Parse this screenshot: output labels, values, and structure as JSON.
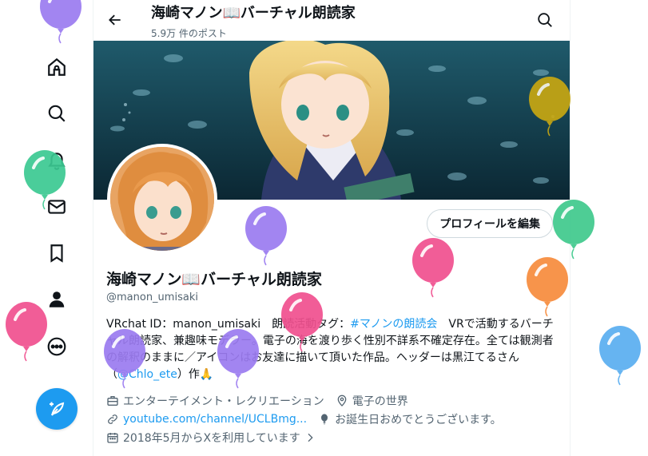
{
  "header": {
    "title": "海崎マノン📖バーチャル朗読家",
    "post_count": "5.9万 件のポスト"
  },
  "profile": {
    "edit_button": "プロフィールを編集",
    "name": "海崎マノン📖バーチャル朗読家",
    "handle": "@manon_umisaki",
    "bio": {
      "part1": "VRchat ID：manon_umisaki　朗読活動タグ：",
      "hashtag": "#マノンの朗読会",
      "part2": "　VRで活動するバーチャル朗読家、兼趣味モデラー。電子の海を渡り歩く性別不詳系不確定存在。全ては観測者の解釈のままに／アイコンはお友達に描いて頂いた作品。ヘッダーは黒江てるさん（",
      "mention": "@Chlo_ete",
      "part3": "）作🙏"
    },
    "category": "エンターテイメント・レクリエーション",
    "location": "電子の世界",
    "url": "youtube.com/channel/UCLBmg...",
    "birthday": "お誕生日おめでとうございます。",
    "joined": "2018年5月からXを利用しています"
  },
  "icons": {
    "nav": [
      "home-icon",
      "explore-icon",
      "notifications-icon",
      "messages-icon",
      "bookmarks-icon",
      "profile-icon",
      "more-icon"
    ],
    "post": "feather-icon",
    "balloon_colors": [
      "#9b7bf0",
      "#3bc992",
      "#f0508f",
      "#c7a712",
      "#f0508f",
      "#9b7bf0",
      "#f78b3c",
      "#3fc98d",
      "#f0508f",
      "#5aaef0",
      "#9b7bf0",
      "#9b7bf0"
    ]
  },
  "colors": {
    "accent": "#1d9bf0",
    "text": "#0f1419",
    "secondary": "#536471"
  }
}
